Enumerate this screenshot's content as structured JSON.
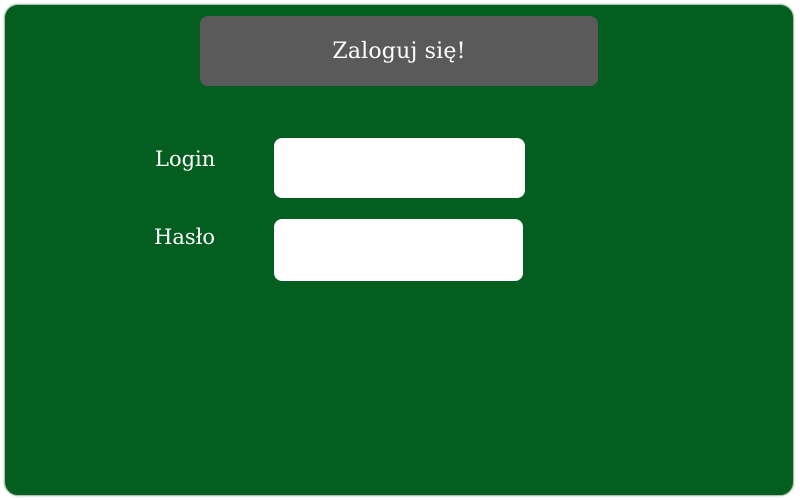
{
  "window": {
    "background_color": "#035e20"
  },
  "header": {
    "title": "Zaloguj się!",
    "background_color": "#5a5a5a"
  },
  "form": {
    "login_label": "Login",
    "login_value": "",
    "password_label": "Hasło",
    "password_value": ""
  }
}
